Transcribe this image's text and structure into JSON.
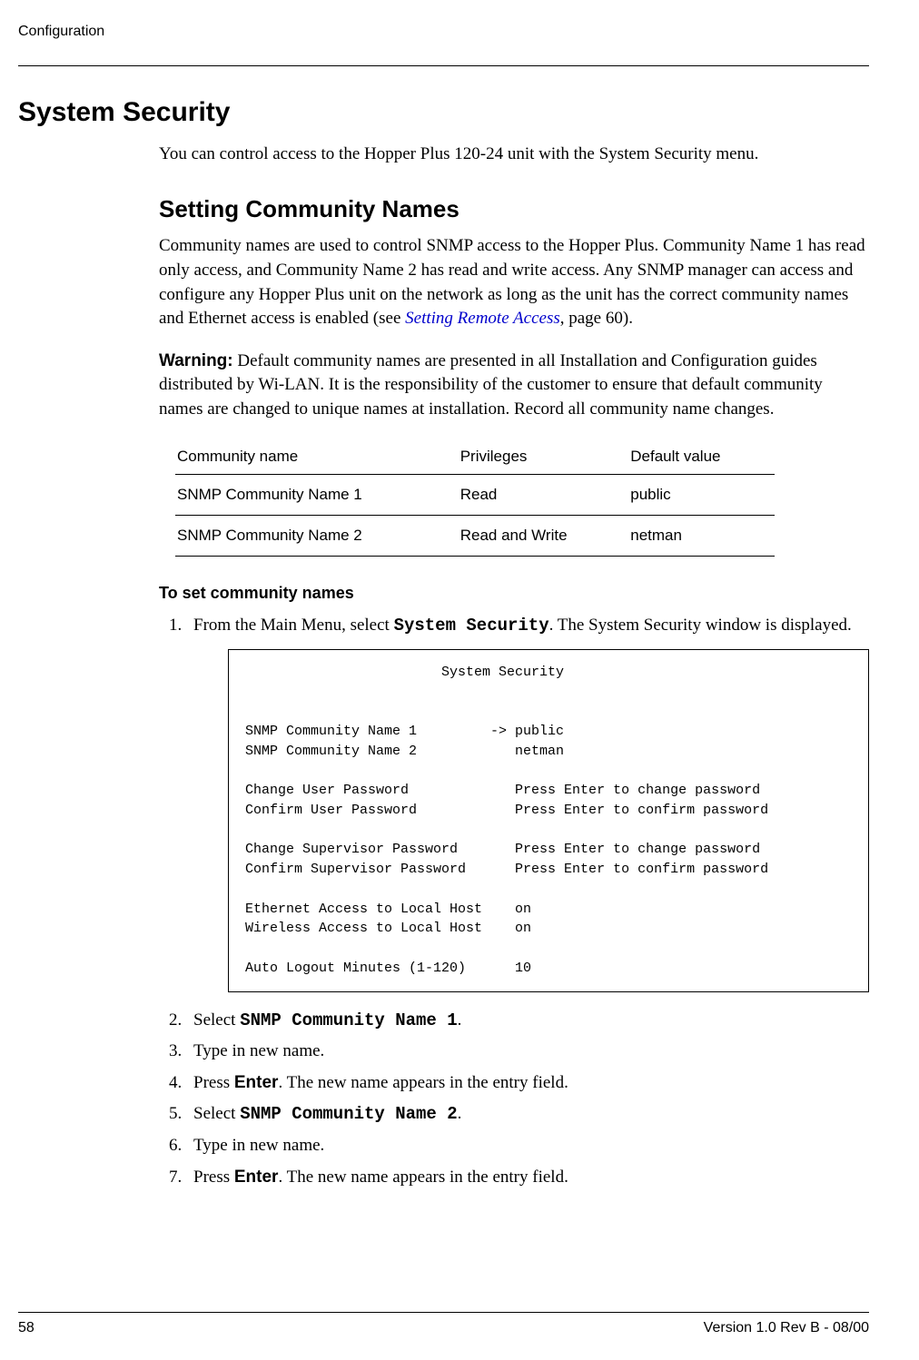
{
  "header": {
    "section": "Configuration"
  },
  "h1": "System Security",
  "intro": "You can control access to the Hopper Plus 120-24 unit with the System Security menu.",
  "h2": "Setting Community Names",
  "para1_a": "Community names are used to control SNMP access to the Hopper Plus. Community Name 1 has read only access, and Community Name 2 has read and write access. Any SNMP manager can access and configure any Hopper Plus unit on the network as long as the unit has the correct community names and Ethernet access is enabled (see ",
  "para1_link": "Setting Remote Access",
  "para1_b": ", page 60).",
  "warning_label": "Warning:",
  "warning_text": " Default community names are presented in all Installation and Configuration guides distributed by Wi-LAN. It is the responsibility of the customer to ensure that default community names are changed to unique names at installation. Record all community name changes.",
  "table": {
    "headers": [
      "Community name",
      "Privileges",
      "Default value"
    ],
    "rows": [
      [
        "SNMP Community Name 1",
        "Read",
        "public"
      ],
      [
        "SNMP Community Name 2",
        "Read and Write",
        "netman"
      ]
    ]
  },
  "proc_title": "To set community names",
  "step1_a": "From the Main Menu, select ",
  "step1_mono": "System Security",
  "step1_b": ". The System Security window is displayed.",
  "terminal": "                        System Security\n\n\nSNMP Community Name 1         -> public\nSNMP Community Name 2            netman\n\nChange User Password             Press Enter to change password\nConfirm User Password            Press Enter to confirm password\n\nChange Supervisor Password       Press Enter to change password\nConfirm Supervisor Password      Press Enter to confirm password\n\nEthernet Access to Local Host    on\nWireless Access to Local Host    on\n\nAuto Logout Minutes (1-120)      10",
  "step2_a": "Select ",
  "step2_mono": "SNMP Community Name 1",
  "step2_b": ".",
  "step3": "Type in new name.",
  "step4_a": "Press ",
  "step4_bold": "Enter",
  "step4_b": ". The new name appears in the entry field.",
  "step5_a": "Select ",
  "step5_mono": "SNMP Community Name 2",
  "step5_b": ".",
  "step6": "Type in new name.",
  "step7_a": "Press ",
  "step7_bold": "Enter",
  "step7_b": ". The new name appears in the entry field.",
  "footer": {
    "page": "58",
    "version": "Version 1.0 Rev B - 08/00"
  }
}
